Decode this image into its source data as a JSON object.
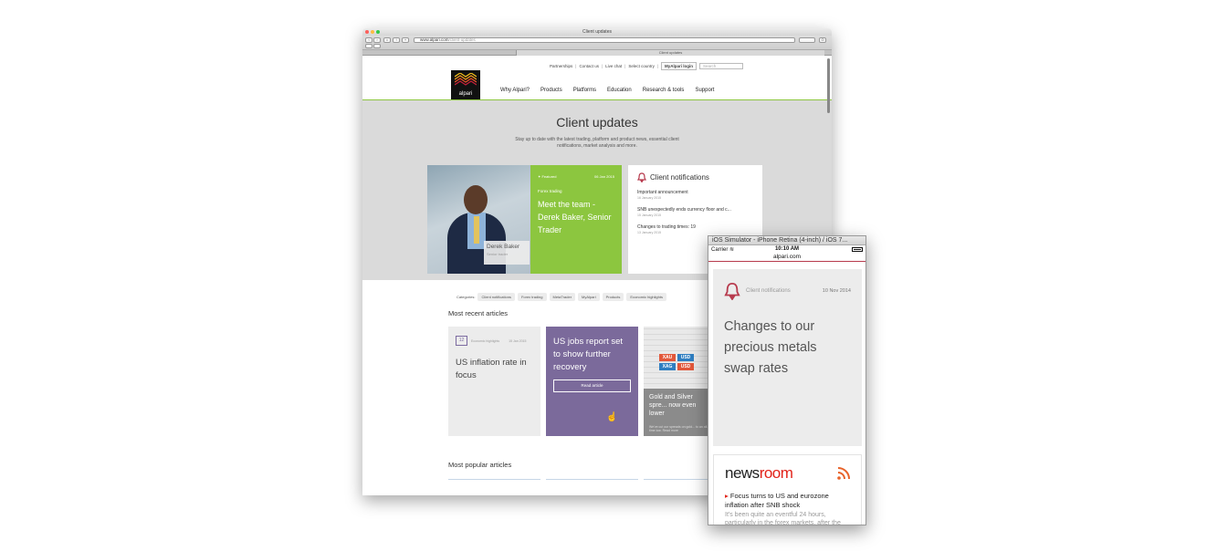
{
  "browser": {
    "window_title": "Client updates",
    "url_domain": "www.alpari.com",
    "url_path": "/client-updates",
    "tab_title": "Client updates"
  },
  "site": {
    "utility_links": [
      "Partnerships",
      "Contact us",
      "Live chat",
      "Select country"
    ],
    "login_label": "MyAlpari login",
    "search_placeholder": "Search",
    "logo_text": "alpari",
    "nav": [
      "Why Alpari?",
      "Products",
      "Platforms",
      "Education",
      "Research & tools",
      "Support"
    ]
  },
  "hero": {
    "title": "Client updates",
    "subtitle": "Stay up to date with the latest trading, platform and product news, essential client notifications, market analysis and more.",
    "person_name": "Derek Baker",
    "person_role": "Senior trader",
    "featured_label": "Featured",
    "featured_date": "06 Jan 2015",
    "featured_category": "Forex trading",
    "featured_title": "Meet the team - Derek Baker, Senior Trader"
  },
  "notifications": {
    "heading": "Client notifications",
    "items": [
      {
        "title": "Important announcement",
        "date": "16 January 2015"
      },
      {
        "title": "SNB unexpectedly ends currency floor and c...",
        "date": "15 January 2015"
      },
      {
        "title": "Changes to trading times: 19",
        "date": "13 January 2015"
      }
    ]
  },
  "categories": {
    "label": "Categories:",
    "items": [
      "Client notifications",
      "Forex trading",
      "MetaTrader",
      "MyAlpari",
      "Products",
      "Economic highlights"
    ]
  },
  "recent": {
    "heading": "Most recent articles",
    "card1": {
      "calendar": "12",
      "category": "Economic highlights",
      "date": "15 Jan 2015",
      "title": "US inflation rate in focus"
    },
    "card2": {
      "title": "US jobs report set to show further recovery",
      "button": "Read article"
    },
    "card3": {
      "tiles": [
        "XAU",
        "USD",
        "XAG",
        "USD"
      ],
      "title": "Gold and Silver spre... now even lower",
      "text": "We've cut our spreads on gold... to an all-time low. Read more"
    }
  },
  "popular": {
    "heading": "Most popular articles"
  },
  "simulator": {
    "title": "iOS Simulator - iPhone Retina (4-inch) / iOS 7...",
    "carrier": "Carrier",
    "time": "10:10 AM",
    "url": "alpari.com",
    "notif_label": "Client notifications",
    "notif_date": "10 Nov 2014",
    "notif_title": "Changes to our precious metals swap rates",
    "newsroom_word_1": "news",
    "newsroom_word_2": "room",
    "news_title": "Focus turns to US and eurozone inflation after SNB shock",
    "news_text": "It's been quite an eventful 24 hours, particularly in the forex markets, after the"
  },
  "colors": {
    "green": "#8cc63f",
    "purple": "#7b6a9b",
    "red": "#b73a4d"
  }
}
